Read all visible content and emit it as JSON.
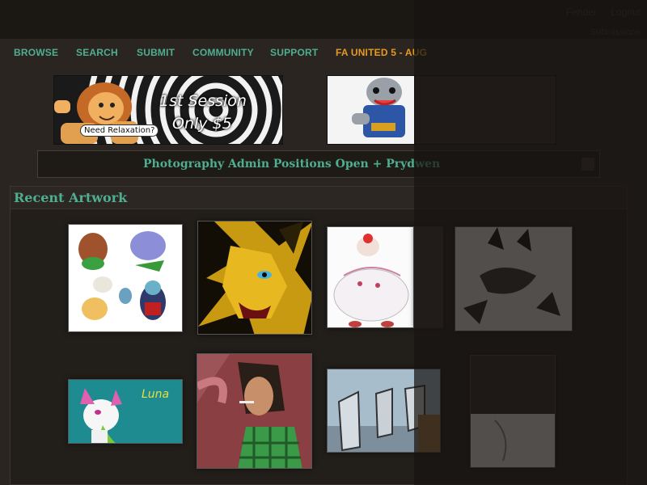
{
  "topbar": {
    "user_link": "Fender",
    "logout_link": "Logout",
    "sub_link": "Submissions"
  },
  "nav": {
    "items": [
      "BROWSE",
      "SEARCH",
      "SUBMIT",
      "COMMUNITY",
      "SUPPORT"
    ],
    "highlight": "FA UNITED 5 - AUG"
  },
  "banner": {
    "line1": "1st Session",
    "line2": "Only $5",
    "bubble": "Need Relaxation?"
  },
  "notice": {
    "text": "Photography Admin Positions Open + Prydwen"
  },
  "recent": {
    "title": "Recent Artwork",
    "art_text": "Luna"
  },
  "colors": {
    "accent": "#4fae92",
    "highlight": "#e79a1f",
    "background": "#2a2520"
  }
}
